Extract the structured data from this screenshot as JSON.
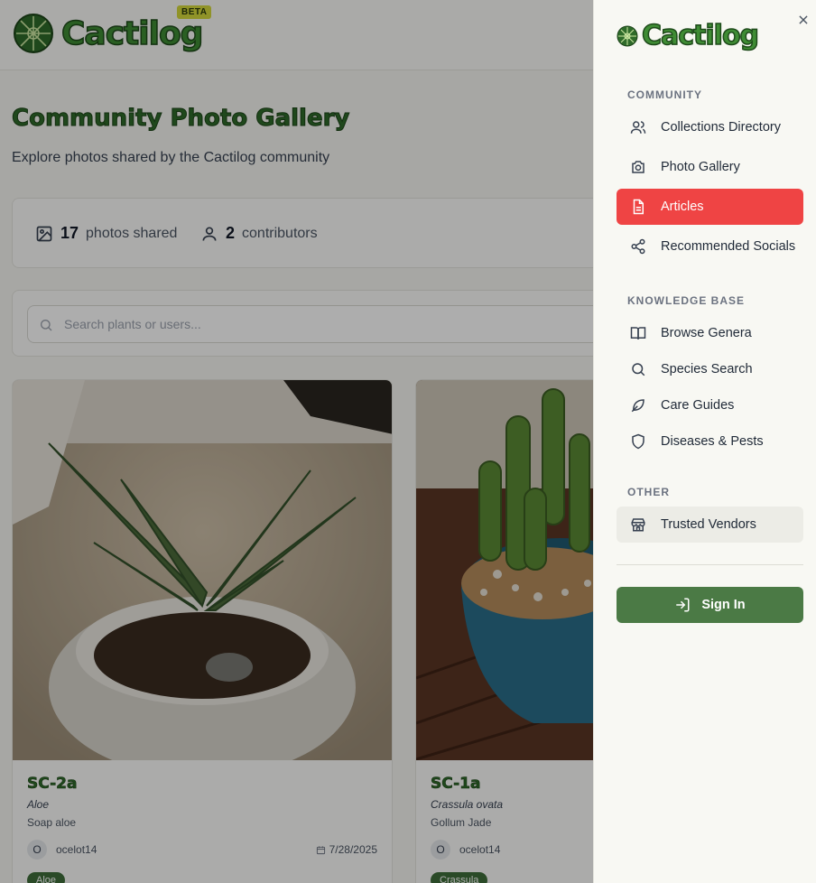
{
  "brand": {
    "name": "Cactilog",
    "beta_label": "BETA"
  },
  "gallery": {
    "title": "Community Photo Gallery",
    "subtitle": "Explore photos shared by the Cactilog community",
    "stats": {
      "photos_count": "17",
      "photos_label": "photos shared",
      "contributors_count": "2",
      "contributors_label": "contributors"
    },
    "search_placeholder": "Search plants or users...",
    "cards": [
      {
        "title": "SC-2a",
        "genus": "Aloe",
        "common_name": "Soap aloe",
        "user_initial": "O",
        "user": "ocelot14",
        "date": "7/28/2025",
        "tag": "Aloe"
      },
      {
        "title": "SC-1a",
        "genus": "Crassula ovata",
        "common_name": "Gollum Jade",
        "user_initial": "O",
        "user": "ocelot14",
        "date": "",
        "tag": "Crassula"
      }
    ]
  },
  "drawer": {
    "sections": [
      {
        "label": "COMMUNITY",
        "items": [
          "Collections Directory",
          "Photo Gallery",
          "Articles",
          "Recommended Socials"
        ]
      },
      {
        "label": "KNOWLEDGE BASE",
        "items": [
          "Browse Genera",
          "Species Search",
          "Care Guides",
          "Diseases & Pests"
        ]
      },
      {
        "label": "OTHER",
        "items": [
          "Trusted Vendors"
        ]
      }
    ],
    "active_item": "Articles",
    "sign_in_label": "Sign In"
  },
  "colors": {
    "active": "#ef4444",
    "brand_green": "#4b7a45",
    "accent_yellow": "#d4d93c"
  }
}
